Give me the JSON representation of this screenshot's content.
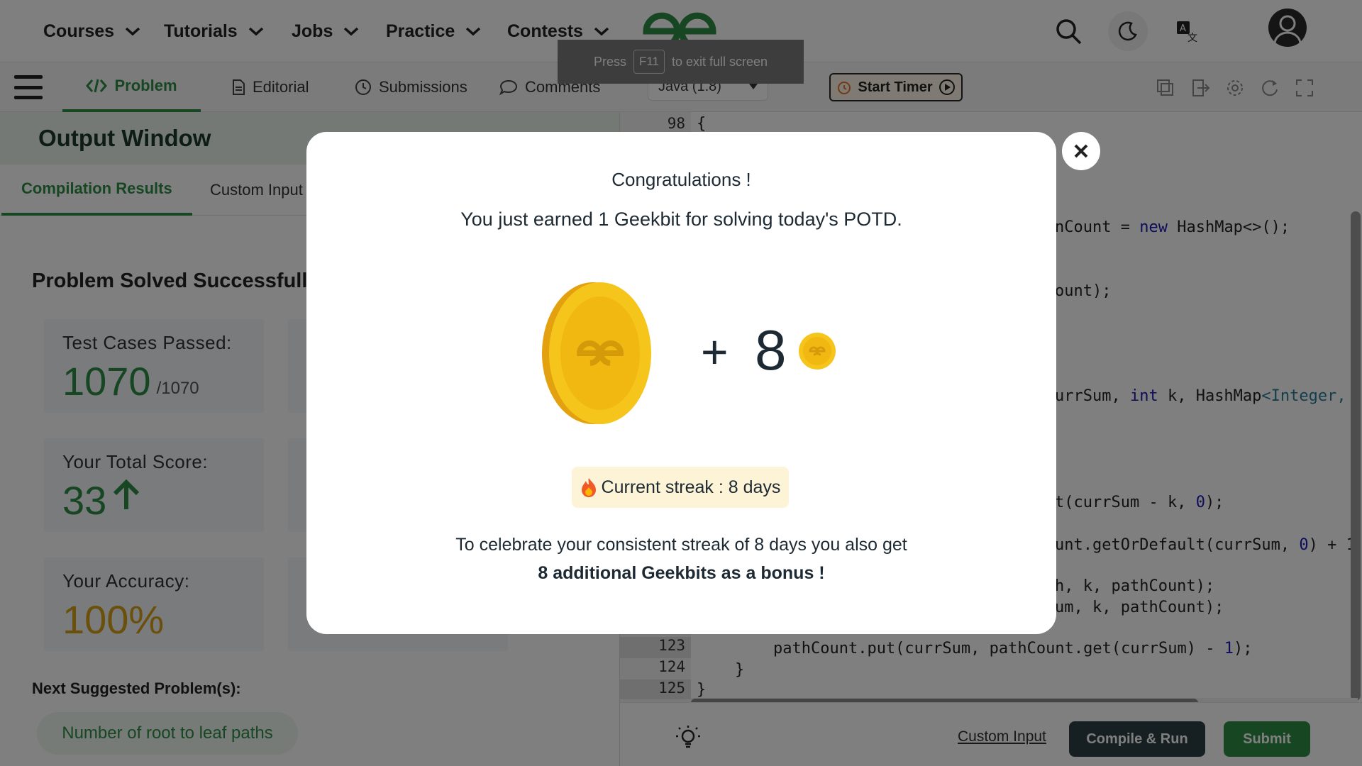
{
  "nav": {
    "items": [
      {
        "label": "Courses"
      },
      {
        "label": "Tutorials"
      },
      {
        "label": "Jobs"
      },
      {
        "label": "Practice"
      },
      {
        "label": "Contests"
      }
    ],
    "icons": [
      "search-icon",
      "moon-icon",
      "translate-icon",
      "user-avatar-icon"
    ]
  },
  "fullscreen_toast": {
    "press": "Press",
    "key": "F11",
    "rest": "to exit full screen"
  },
  "problem_tabs": [
    {
      "label": "Problem",
      "icon": "code-icon"
    },
    {
      "label": "Editorial",
      "icon": "document-icon"
    },
    {
      "label": "Submissions",
      "icon": "clock-icon"
    },
    {
      "label": "Comments",
      "icon": "comment-icon"
    }
  ],
  "editor_toolbar": {
    "language": "Java (1.8)",
    "timer_label": "Start Timer",
    "icons": [
      "copy-icon",
      "import-icon",
      "settings-icon",
      "reset-icon",
      "fullscreen-icon"
    ]
  },
  "output": {
    "title": "Output Window",
    "tabs": [
      {
        "label": "Compilation Results"
      },
      {
        "label": "Custom Input"
      }
    ],
    "status": "Problem Solved Successfully",
    "cards": {
      "tests_label": "Test Cases Passed:",
      "tests_value": "1070",
      "tests_total": "/1070",
      "score_label": "Your Total Score:",
      "score_value": "33",
      "accuracy_label": "Your Accuracy:",
      "accuracy_value": "100%"
    },
    "next_label": "Next Suggested Problem(s):",
    "next_problem": "Number of root to leaf paths"
  },
  "code": {
    "line_numbers": {
      "l98": "98",
      "l123": "123",
      "l124": "124",
      "l125": "125"
    },
    "lines": {
      "l98": "{",
      "hashmap_pre": "nCount ",
      "hashmap_eq": "= ",
      "hashmap_new": "new",
      "hashmap_post": " HashMap<>();",
      "ount": "ount);",
      "sig_pre": "urrSum, ",
      "sig_int": "int",
      "sig_mid": " k, HashMap",
      "sig_type": "<Integer,",
      "get_pre": "t(currSum - k, ",
      "get_zero": "0",
      "get_post": ");",
      "getor_pre": "unt.getOrDefault(currSum, ",
      "getor_zero": "0",
      "getor_post": ") + 1",
      "rec1": "h, k, pathCount);",
      "rec2": "um, k, pathCount);",
      "l123_pre": "pathCount.put(currSum, pathCount.get(currSum) - ",
      "l123_one": "1",
      "l123_post": ");",
      "l124": "}",
      "l125": "}"
    }
  },
  "bottom": {
    "custom_input": "Custom Input",
    "compile_run": "Compile & Run",
    "submit": "Submit"
  },
  "modal": {
    "title": "Congratulations !",
    "subtitle": "You just earned 1 Geekbit for solving today's POTD.",
    "plus": "+",
    "bonus_count": "8",
    "streak": "Current streak : 8 days",
    "body_line1": "To celebrate your consistent streak of 8 days you also get",
    "body_line2": "8 additional Geekbits as a bonus !"
  },
  "colors": {
    "brand_green": "#2f8d46",
    "dark_button": "#2c3e44",
    "accuracy": "#d4a017",
    "coin_gold": "#f6c51b"
  }
}
